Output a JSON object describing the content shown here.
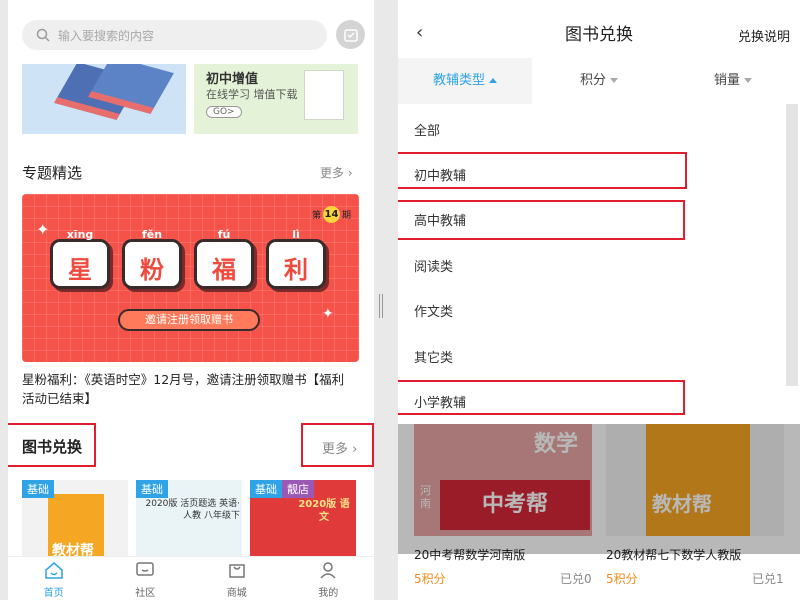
{
  "left": {
    "search_placeholder": "输入要搜索的内容",
    "banner_right": {
      "title": "初中增值",
      "subtitle": "在线学习 增值下载",
      "go": "GO>"
    },
    "special": {
      "title": "专题精选",
      "more": "更多"
    },
    "promo": {
      "issue_prefix": "第",
      "issue_no": "14",
      "issue_suffix": "期",
      "chars": [
        {
          "pinyin": "xīng",
          "char": "星"
        },
        {
          "pinyin": "fěn",
          "char": "粉"
        },
        {
          "pinyin": "fú",
          "char": "福"
        },
        {
          "pinyin": "lì",
          "char": "利"
        }
      ],
      "invite": "邀请注册领取赠书",
      "caption": "星粉福利：《英语时空》12月号，邀请注册领取赠书【福利活动已结束】"
    },
    "exchange": {
      "title": "图书兑换",
      "more": "更多"
    },
    "books": [
      {
        "tag": "基础",
        "cover_text": "教材帮"
      },
      {
        "tag": "基础",
        "cover_text": "2020版 活页题选 英语·人教 八年级下"
      },
      {
        "tag": "基础",
        "badge": "靓店",
        "cover_text": "2020版 语文"
      }
    ],
    "tabs": [
      {
        "label": "首页",
        "icon": "home-icon"
      },
      {
        "label": "社区",
        "icon": "community-icon"
      },
      {
        "label": "商城",
        "icon": "shop-icon"
      },
      {
        "label": "我的",
        "icon": "user-icon"
      }
    ]
  },
  "right": {
    "title": "图书兑换",
    "help": "兑换说明",
    "filters": [
      {
        "label": "教辅类型",
        "active": true
      },
      {
        "label": "积分",
        "active": false
      },
      {
        "label": "销量",
        "active": false
      }
    ],
    "options": [
      "全部",
      "初中教辅",
      "高中教辅",
      "阅读类",
      "作文类",
      "其它类",
      "小学教辅"
    ],
    "books": [
      {
        "name": "20中考帮数学河南版",
        "points": "5积分",
        "redeemed": "已兑0",
        "cover_title": "中考帮",
        "cover_sub": "数学",
        "cover_region": "河南"
      },
      {
        "name": "20教材帮七下数学人教版",
        "points": "5积分",
        "redeemed": "已兑1",
        "cover_title": "教材帮"
      }
    ]
  },
  "colors": {
    "accent": "#2fa3e6",
    "highlight": "#e01e2d",
    "points": "#f08c1e",
    "promo": "#f5534a"
  }
}
